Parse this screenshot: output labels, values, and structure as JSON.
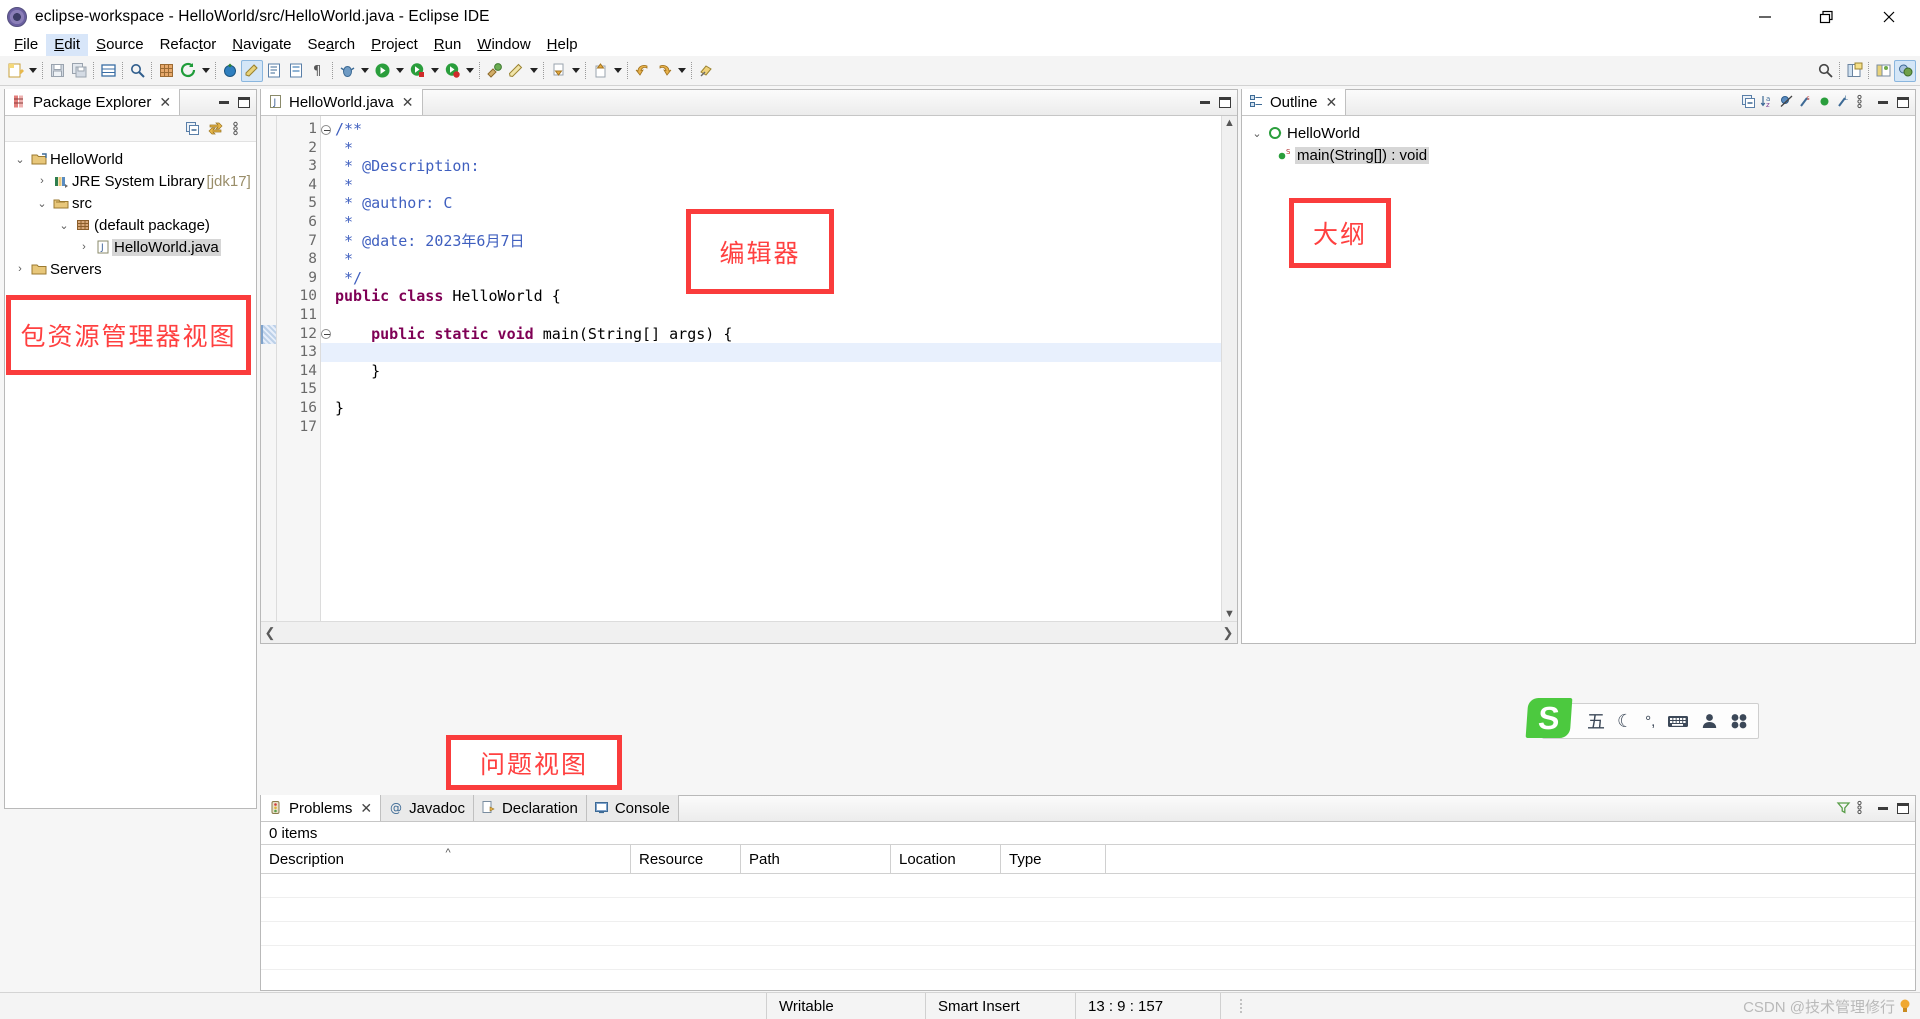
{
  "window": {
    "title": "eclipse-workspace - HelloWorld/src/HelloWorld.java - Eclipse IDE",
    "icon": "eclipse-logo-icon",
    "controls": {
      "minimize": "minimize-icon",
      "restore": "restore-icon",
      "close": "close-icon"
    }
  },
  "menubar": {
    "items": [
      {
        "label": "File",
        "mnemonic": "F"
      },
      {
        "label": "Edit",
        "mnemonic": "E",
        "selected": true
      },
      {
        "label": "Source",
        "mnemonic": "S"
      },
      {
        "label": "Refactor",
        "mnemonic": "t"
      },
      {
        "label": "Navigate",
        "mnemonic": "N"
      },
      {
        "label": "Search",
        "mnemonic": "a"
      },
      {
        "label": "Project",
        "mnemonic": "P"
      },
      {
        "label": "Run",
        "mnemonic": "R"
      },
      {
        "label": "Window",
        "mnemonic": "W"
      },
      {
        "label": "Help",
        "mnemonic": "H"
      }
    ]
  },
  "toolbar": {
    "groups": [
      [
        "new-wizard-icon",
        "dropdown-arrow"
      ],
      [
        "save-icon",
        "save-all-icon"
      ],
      [
        "new-java-package-icon"
      ],
      [
        "search-icon"
      ],
      [
        "open-type-icon",
        "refresh-icon",
        "dropdown-arrow"
      ],
      [
        "debug-last-icon",
        "annotate-icon",
        "open-task-icon",
        "outline-toggle-icon",
        "show-whitespace-icon"
      ],
      [
        "debug-icon",
        "dropdown-arrow",
        "run-icon",
        "dropdown-arrow",
        "run-coverage-icon",
        "dropdown-arrow",
        "profile-icon",
        "dropdown-arrow"
      ],
      [
        "external-tools-icon",
        "pencil-icon",
        "dropdown-arrow"
      ],
      [
        "previous-annotation-icon",
        "dropdown-arrow"
      ],
      [
        "next-annotation-icon",
        "dropdown-arrow"
      ],
      [
        "back-icon",
        "forward-icon",
        "dropdown-arrow"
      ],
      [
        "pin-editor-icon"
      ]
    ],
    "right": [
      "quick-access-search-icon",
      "open-perspective-icon",
      "java-perspective-icon",
      "java-ee-perspective-icon"
    ]
  },
  "package_explorer": {
    "tab_label": "Package Explorer",
    "tab_icon": "package-explorer-icon",
    "close_icon": "close-icon",
    "tools": [
      "collapse-all-icon",
      "link-with-editor-icon",
      "view-menu-icon"
    ],
    "minimize_icon": "minimize-icon",
    "maximize_icon": "maximize-icon",
    "tree": [
      {
        "label": "HelloWorld",
        "icon": "java-project-icon",
        "twisty": "expanded",
        "indent": 0
      },
      {
        "label": "JRE System Library",
        "suffix": " [jdk17]",
        "icon": "jre-library-icon",
        "twisty": "collapsed",
        "indent": 1
      },
      {
        "label": "src",
        "icon": "source-folder-icon",
        "twisty": "expanded",
        "indent": 1
      },
      {
        "label": "(default package)",
        "icon": "package-icon",
        "twisty": "expanded",
        "indent": 2
      },
      {
        "label": "HelloWorld.java",
        "icon": "java-file-icon",
        "twisty": "collapsed",
        "indent": 3,
        "selected": true
      },
      {
        "label": "Servers",
        "icon": "folder-icon",
        "twisty": "collapsed",
        "indent": 0
      }
    ]
  },
  "editor": {
    "tab_label": "HelloWorld.java",
    "tab_icon": "java-file-icon",
    "close_icon": "close-icon",
    "minimize_icon": "minimize-icon",
    "maximize_icon": "maximize-icon",
    "current_line": 13,
    "lines": [
      {
        "n": 1,
        "fold": true,
        "tokens": [
          {
            "t": "/**",
            "c": "cmt"
          }
        ]
      },
      {
        "n": 2,
        "tokens": [
          {
            "t": " *",
            "c": "cmt"
          }
        ]
      },
      {
        "n": 3,
        "tokens": [
          {
            "t": " * @Description: ",
            "c": "cmt"
          }
        ]
      },
      {
        "n": 4,
        "tokens": [
          {
            "t": " *",
            "c": "cmt"
          }
        ]
      },
      {
        "n": 5,
        "tokens": [
          {
            "t": " * @author: C",
            "c": "cmt"
          }
        ]
      },
      {
        "n": 6,
        "tokens": [
          {
            "t": " *",
            "c": "cmt"
          }
        ]
      },
      {
        "n": 7,
        "tokens": [
          {
            "t": " * @date: 2023年6月7日",
            "c": "cmt"
          }
        ]
      },
      {
        "n": 8,
        "tokens": [
          {
            "t": " *",
            "c": "cmt"
          }
        ]
      },
      {
        "n": 9,
        "tokens": [
          {
            "t": " */",
            "c": "cmt"
          }
        ]
      },
      {
        "n": 10,
        "tokens": [
          {
            "t": "public class ",
            "c": "kw"
          },
          {
            "t": "HelloWorld {",
            "c": "plain"
          }
        ]
      },
      {
        "n": 11,
        "tokens": []
      },
      {
        "n": 12,
        "fold": true,
        "tokens": [
          {
            "t": "    ",
            "c": "plain"
          },
          {
            "t": "public static void ",
            "c": "kw"
          },
          {
            "t": "main(String[] args) {",
            "c": "plain"
          }
        ]
      },
      {
        "n": 13,
        "tokens": []
      },
      {
        "n": 14,
        "tokens": [
          {
            "t": "    }",
            "c": "plain"
          }
        ]
      },
      {
        "n": 15,
        "tokens": []
      },
      {
        "n": 16,
        "tokens": [
          {
            "t": "}",
            "c": "plain"
          }
        ]
      },
      {
        "n": 17,
        "tokens": []
      }
    ]
  },
  "outline": {
    "tab_label": "Outline",
    "tab_icon": "outline-icon",
    "close_icon": "close-icon",
    "tools": [
      "collapse-all-icon",
      "sort-icon",
      "hide-fields-icon",
      "hide-static-icon",
      "hide-non-public-icon",
      "hide-local-types-icon",
      "view-menu-icon"
    ],
    "minimize_icon": "minimize-icon",
    "maximize_icon": "maximize-icon",
    "tree": [
      {
        "label": "HelloWorld",
        "icon": "class-icon",
        "twisty": "expanded",
        "indent": 0
      },
      {
        "label": "main(String[]) : void",
        "icon": "public-static-method-icon",
        "indent": 1,
        "selected": true
      }
    ]
  },
  "bottom_panel": {
    "tabs": [
      {
        "label": "Problems",
        "icon": "problems-icon",
        "active": true,
        "close_icon": "close-icon"
      },
      {
        "label": "Javadoc",
        "icon": "javadoc-icon",
        "active": false
      },
      {
        "label": "Declaration",
        "icon": "declaration-icon",
        "active": false
      },
      {
        "label": "Console",
        "icon": "console-icon",
        "active": false
      }
    ],
    "tools": [
      "filter-icon",
      "view-menu-icon"
    ],
    "minimize_icon": "minimize-icon",
    "maximize_icon": "maximize-icon",
    "items_count": "0 items",
    "columns": [
      "Description",
      "Resource",
      "Path",
      "Location",
      "Type"
    ],
    "sort_column": "Description",
    "sort_caret": "^",
    "rows": []
  },
  "statusbar": {
    "writable": "Writable",
    "insert_mode": "Smart Insert",
    "position": "13 : 9 : 157",
    "watermark": "CSDN @技术管理修行"
  },
  "annotations": [
    {
      "text": "编辑器",
      "name": "annotation-editor"
    },
    {
      "text": "包资源管理器视图",
      "name": "annotation-package-explorer"
    },
    {
      "text": "大纲",
      "name": "annotation-outline"
    },
    {
      "text": "问题视图",
      "name": "annotation-problems-view"
    }
  ],
  "ime": {
    "logo": "sogou-logo-icon",
    "logo_text": "S",
    "buttons": [
      {
        "glyph": "五",
        "name": "wubi-mode-icon"
      },
      {
        "glyph": "☾",
        "name": "moon-mode-icon"
      },
      {
        "glyph": "°,",
        "name": "punctuation-mode-icon"
      },
      {
        "glyph": "⌨",
        "name": "soft-keyboard-icon"
      },
      {
        "glyph": "👤",
        "name": "user-icon"
      },
      {
        "glyph": "⛶",
        "name": "toolbox-icon"
      }
    ]
  }
}
